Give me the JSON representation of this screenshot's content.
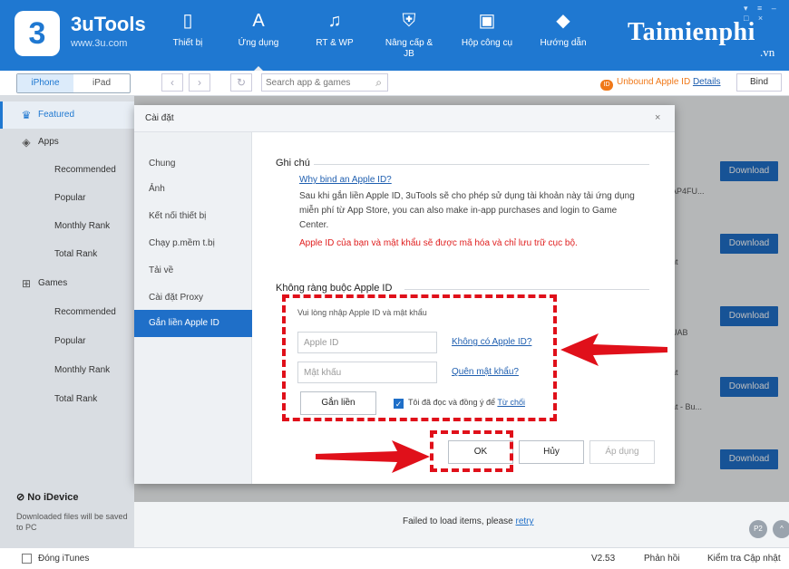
{
  "app": {
    "name": "3uTools",
    "url": "www.3u.com",
    "logo_glyph": "3"
  },
  "nav": [
    {
      "label": "Thiết bị",
      "icon": "phone-icon",
      "glyph": "▯"
    },
    {
      "label": "Ứng dụng",
      "icon": "apps-icon",
      "glyph": "A",
      "active": true
    },
    {
      "label": "RT & WP",
      "icon": "music-icon",
      "glyph": "♫"
    },
    {
      "label": "Nâng cấp & JB",
      "icon": "shield-icon",
      "glyph": "⛨"
    },
    {
      "label": "Hộp công cụ",
      "icon": "toolbox-icon",
      "glyph": "▣"
    },
    {
      "label": "Hướng dẫn",
      "icon": "graduation-icon",
      "glyph": "◆"
    }
  ],
  "brand": {
    "name": "Taimienphi",
    "suffix": ".vn"
  },
  "toolbar": {
    "seg": [
      "iPhone",
      "iPad"
    ],
    "search_placeholder": "Search app & games",
    "unbound_badge": "ID",
    "unbound_text": "Unbound Apple ID",
    "details": "Details",
    "bind": "Bind"
  },
  "sidebar": {
    "featured": "Featured",
    "apps": "Apps",
    "apps_items": [
      "Recommended",
      "Popular",
      "Monthly Rank",
      "Total Rank"
    ],
    "games": "Games",
    "games_items": [
      "Recommended",
      "Popular",
      "Monthly Rank",
      "Total Rank"
    ],
    "no_idevice": "No iDevice",
    "no_idevice_desc": "Downloaded files will be saved to PC"
  },
  "main": {
    "download": "Download",
    "peek": [
      "AP4FU...",
      "nt",
      "UAB",
      "at",
      "at - Bu..."
    ],
    "failed": "Failed to load items, please",
    "retry": "retry",
    "pills": [
      "P2",
      "^"
    ]
  },
  "status": {
    "itunes": "Đóng iTunes",
    "version": "V2.53",
    "feedback": "Phản hồi",
    "update": "Kiểm tra Cập nhật"
  },
  "dialog": {
    "title": "Cài đặt",
    "close": "×",
    "nav": [
      "Chung",
      "Ảnh",
      "Kết nối thiết bị",
      "Chạy p.mềm t.bị",
      "Tải về",
      "Cài đặt Proxy",
      "Gắn liền Apple ID"
    ],
    "note_title": "Ghi chú",
    "note_link": "Why bind an Apple ID?",
    "note_text": "Sau khi gắn liền Apple ID, 3uTools sẽ cho phép sử dụng tài khoản này tải ứng dụng miễn phí từ App Store, you can also make in-app purchases and login to Game Center.",
    "note_red": "Apple ID của bạn và mật khẩu sẽ được mã hóa và chỉ lưu trữ cục bộ.",
    "section_title": "Không ràng buộc Apple ID",
    "instruction": "Vui lòng nhập Apple ID và mật khẩu",
    "appleid_placeholder": "Apple ID",
    "no_appleid": "Không có Apple ID?",
    "password_placeholder": "Mật khẩu",
    "forgot": "Quên mật khẩu?",
    "bind_now": "Gắn liền",
    "agree_text": "Tôi đã đọc và đồng ý để",
    "refuse": "Từ chối",
    "ok": "OK",
    "cancel": "Hủy",
    "apply": "Áp dụng"
  },
  "colors": {
    "accent": "#1f78d1",
    "annotation": "#e0101a",
    "warning": "#e02020"
  }
}
